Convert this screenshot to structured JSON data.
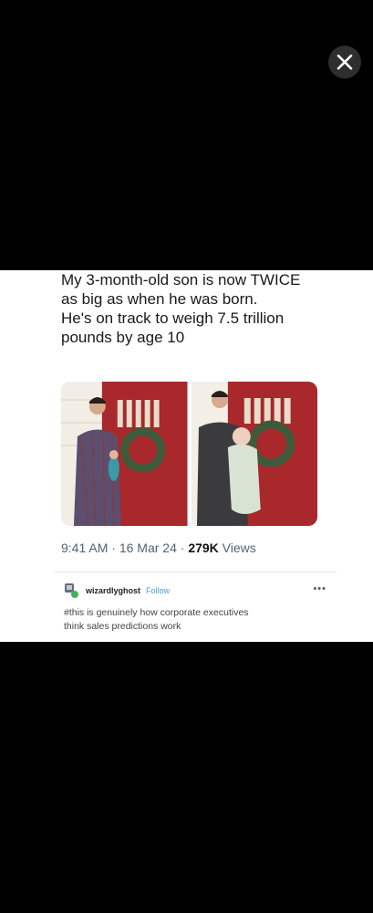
{
  "tweet": {
    "line1": "My 3-month-old son is now TWICE",
    "line2": "as big as when he was born.",
    "line3": "He's on track to weigh 7.5 trillion",
    "line4": "pounds by age 10"
  },
  "meta": {
    "time": "9:41 AM",
    "sep1": " · ",
    "date": "16 Mar 24",
    "sep2": " · ",
    "views_count": "279K",
    "views_label": " Views"
  },
  "tumblr": {
    "username": "wizardlyghost",
    "follow_label": "Follow",
    "more": "•••",
    "tag_line1": "#this is genuinely how corporate executives",
    "tag_line2": "think sales predictions work"
  },
  "icons": {
    "close": "close-icon",
    "more": "more-dots-icon"
  },
  "colors": {
    "background": "#000000",
    "card": "#ffffff",
    "follow": "#46a2d9",
    "door": "#a8282b"
  }
}
